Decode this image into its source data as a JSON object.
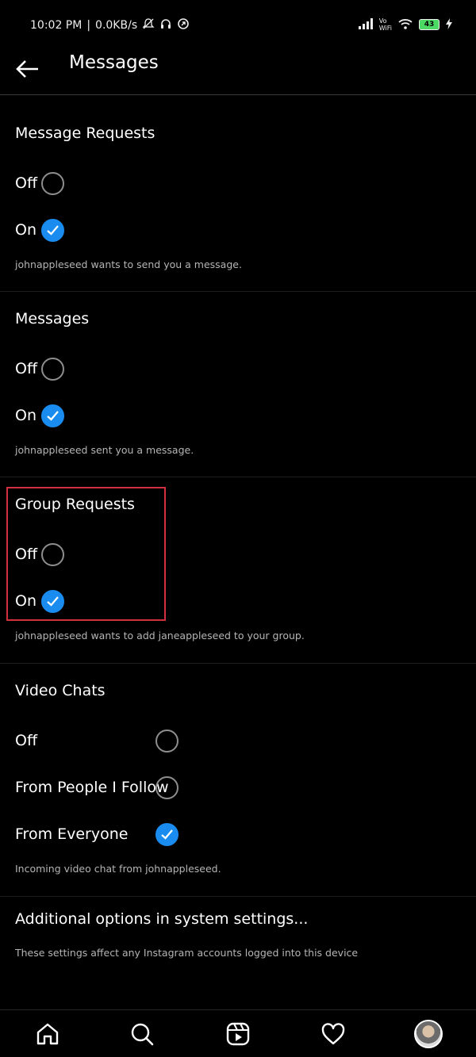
{
  "status_bar": {
    "time": "10:02 PM",
    "net_speed": "0.0KB/s",
    "wifi_label_vo": "Vo",
    "wifi_label_wifi": "WiFi",
    "battery": "43"
  },
  "header": {
    "title": "Messages"
  },
  "sections": [
    {
      "title": "Message Requests",
      "options": [
        {
          "label": "Off",
          "checked": false
        },
        {
          "label": "On",
          "checked": true
        }
      ],
      "helper": "johnappleseed wants to send you a message."
    },
    {
      "title": "Messages",
      "options": [
        {
          "label": "Off",
          "checked": false
        },
        {
          "label": "On",
          "checked": true
        }
      ],
      "helper": "johnappleseed sent you a message."
    },
    {
      "title": "Group Requests",
      "options": [
        {
          "label": "Off",
          "checked": false
        },
        {
          "label": "On",
          "checked": true
        }
      ],
      "helper": "johnappleseed wants to add janeappleseed to your group."
    },
    {
      "title": "Video Chats",
      "options": [
        {
          "label": "Off",
          "checked": false
        },
        {
          "label": "From People I Follow",
          "checked": false
        },
        {
          "label": "From Everyone",
          "checked": true
        }
      ],
      "helper": "Incoming video chat from johnappleseed."
    }
  ],
  "additional": {
    "title": "Additional options in system settings...",
    "helper": "These settings affect any Instagram accounts logged into this device"
  },
  "bottom_nav": [
    "home-icon",
    "search-icon",
    "reels-icon",
    "heart-icon",
    "profile-avatar"
  ],
  "colors": {
    "accent": "#1a8cf0",
    "highlight": "#d3303f",
    "background": "#000000"
  }
}
